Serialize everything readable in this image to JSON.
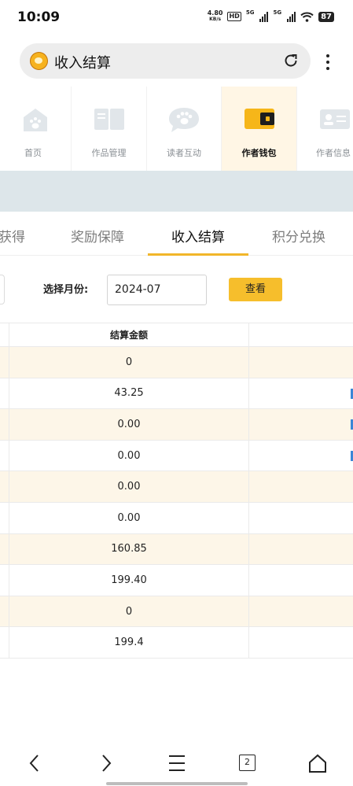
{
  "status_bar": {
    "time": "10:09",
    "net_speed_value": "4.80",
    "net_speed_unit": "KB/s",
    "hd_label": "HD",
    "sig1_label": "5G",
    "sig2_label": "5G",
    "battery": "87"
  },
  "browser": {
    "title": "收入结算",
    "reload_icon": "reload-icon",
    "menu_icon": "more-vertical-icon"
  },
  "nav": {
    "items": [
      {
        "label": "首页",
        "icon": "home-cat-icon",
        "active": false
      },
      {
        "label": "作品管理",
        "icon": "book-icon",
        "active": false
      },
      {
        "label": "读者互动",
        "icon": "paw-chat-icon",
        "active": false
      },
      {
        "label": "作者钱包",
        "icon": "wallet-icon",
        "active": true
      },
      {
        "label": "作者信息",
        "icon": "id-card-icon",
        "active": false
      }
    ]
  },
  "tabs": [
    {
      "label": "获得",
      "active": false
    },
    {
      "label": "奖励保障",
      "active": false
    },
    {
      "label": "收入结算",
      "active": true
    },
    {
      "label": "积分兑换",
      "active": false
    }
  ],
  "filter": {
    "month_label": "选择月份:",
    "month_value": "2024-07",
    "view_button": "查看"
  },
  "table": {
    "header": "结算金额",
    "rows": [
      "0",
      "43.25",
      "0.00",
      "0.00",
      "0.00",
      "0.00",
      "160.85",
      "199.40",
      "0",
      "199.4"
    ]
  },
  "colors": {
    "accent": "#f6be2c",
    "active_tab_underline": "#f1b62a",
    "row_highlight": "#fdf6e8",
    "nav_active_bg": "#fff6e5",
    "band": "#dde6ea"
  },
  "bottom_nav": {
    "tab_count": "2",
    "icons": [
      "back-icon",
      "forward-icon",
      "menu-icon",
      "tabs-icon",
      "home-icon"
    ]
  }
}
